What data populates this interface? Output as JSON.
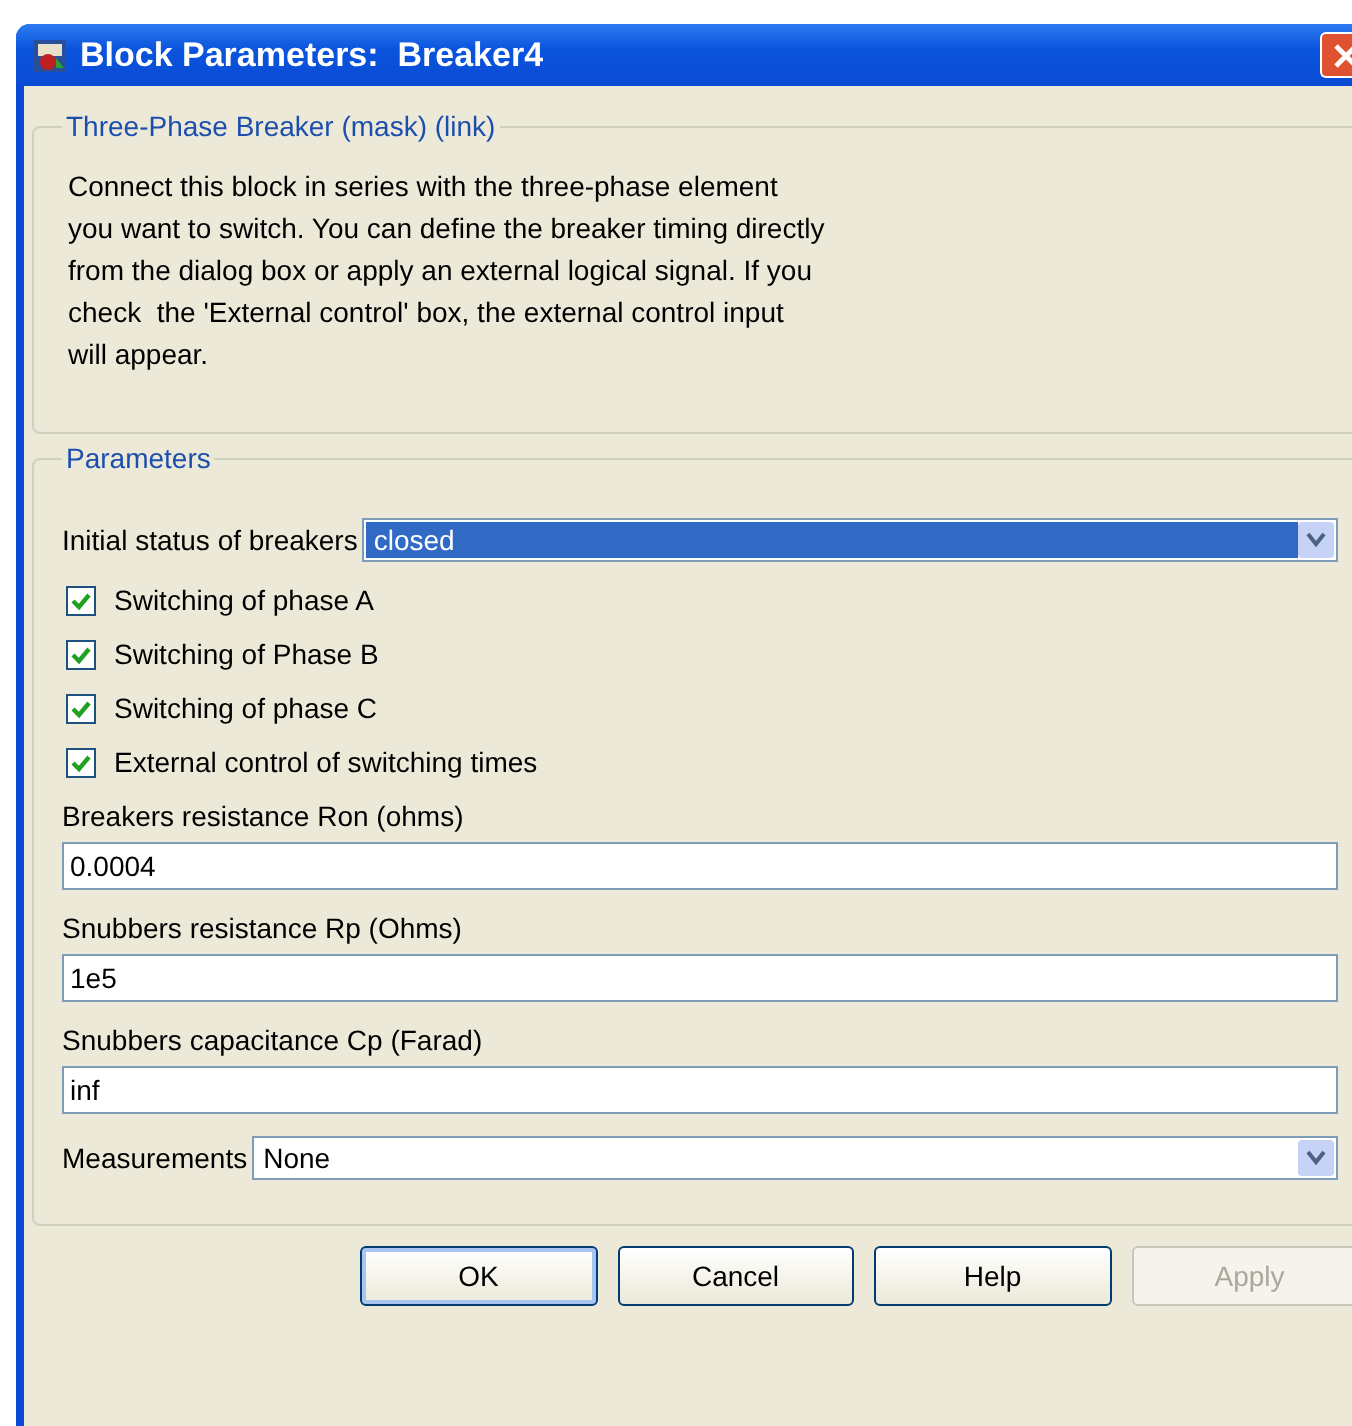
{
  "window": {
    "title": "Block Parameters:  Breaker4"
  },
  "description_group": {
    "title": "Three-Phase Breaker (mask) (link)",
    "text": "Connect this block in series with the three-phase element\nyou want to switch. You can define the breaker timing directly\nfrom the dialog box or apply an external logical signal. If you\ncheck  the 'External control' box, the external control input\nwill appear."
  },
  "parameters_group": {
    "title": "Parameters",
    "items": [
      {
        "kind": "dropdown",
        "label": "Initial status of breakers",
        "value": "closed",
        "focused": true
      },
      {
        "kind": "checkbox",
        "label": "Switching of phase A",
        "checked": true
      },
      {
        "kind": "checkbox",
        "label": "Switching of Phase B",
        "checked": true
      },
      {
        "kind": "checkbox",
        "label": "Switching of phase C",
        "checked": true
      },
      {
        "kind": "checkbox",
        "label": "External control of switching times",
        "checked": true
      },
      {
        "kind": "field",
        "label": "Breakers resistance Ron (ohms)",
        "value": "0.0004"
      },
      {
        "kind": "field",
        "label": "Snubbers resistance Rp (Ohms)",
        "value": "1e5"
      },
      {
        "kind": "field",
        "label": "Snubbers capacitance Cp (Farad)",
        "value": "inf"
      },
      {
        "kind": "dropdown",
        "label": "Measurements",
        "value": "None",
        "focused": false
      }
    ]
  },
  "buttons": [
    {
      "label": "OK",
      "default": true,
      "disabled": false
    },
    {
      "label": "Cancel",
      "default": false,
      "disabled": false
    },
    {
      "label": "Help",
      "default": false,
      "disabled": false
    },
    {
      "label": "Apply",
      "default": false,
      "disabled": true
    }
  ]
}
